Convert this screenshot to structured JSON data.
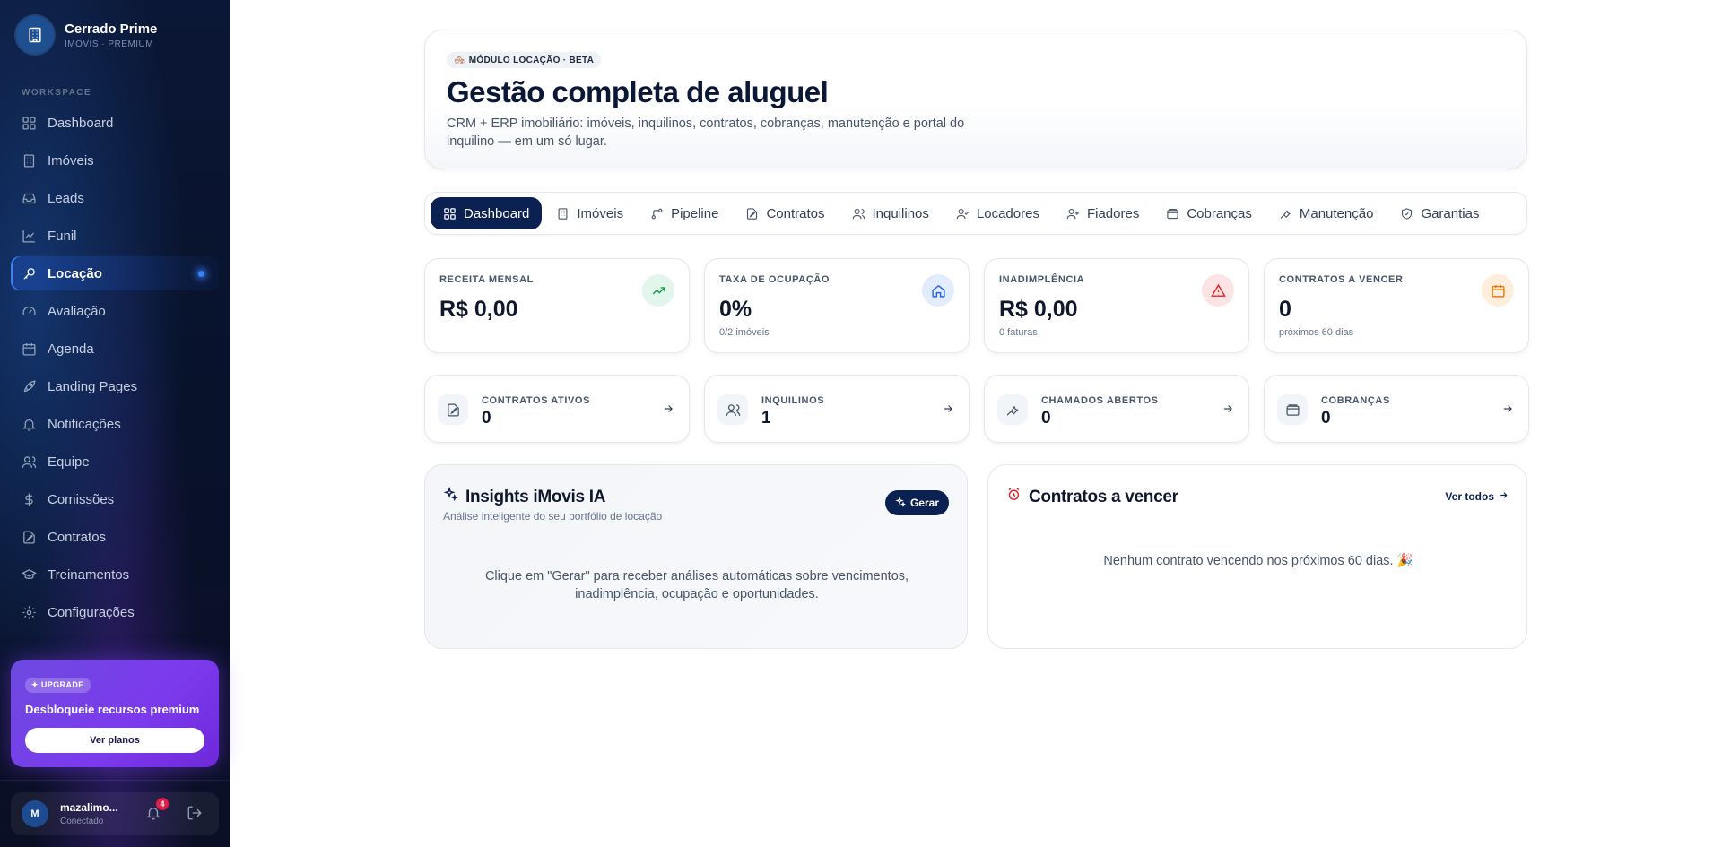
{
  "brand": {
    "name": "Cerrado Prime",
    "subtitle": "IMOVIS · PREMIUM"
  },
  "sidebar": {
    "section_label": "WORKSPACE",
    "items": [
      {
        "label": "Dashboard",
        "icon": "grid-icon"
      },
      {
        "label": "Imóveis",
        "icon": "building-icon"
      },
      {
        "label": "Leads",
        "icon": "inbox-icon"
      },
      {
        "label": "Funil",
        "icon": "chart-line-icon"
      },
      {
        "label": "Locação",
        "icon": "key-icon",
        "active": true
      },
      {
        "label": "Avaliação",
        "icon": "gauge-icon"
      },
      {
        "label": "Agenda",
        "icon": "calendar-icon"
      },
      {
        "label": "Landing Pages",
        "icon": "rocket-icon"
      },
      {
        "label": "Notificações",
        "icon": "bell-icon"
      },
      {
        "label": "Equipe",
        "icon": "users-icon"
      },
      {
        "label": "Comissões",
        "icon": "dollar-icon"
      },
      {
        "label": "Contratos",
        "icon": "file-signature-icon"
      },
      {
        "label": "Treinamentos",
        "icon": "graduation-cap-icon"
      },
      {
        "label": "Configurações",
        "icon": "gear-icon"
      }
    ],
    "upgrade": {
      "badge": "UPGRADE",
      "title": "Desbloqueie recursos premium",
      "button": "Ver planos"
    },
    "user": {
      "initial": "M",
      "name": "mazalimo...",
      "status": "Conectado",
      "notifications": "4"
    }
  },
  "hero": {
    "badge": "MÓDULO LOCAÇÃO · BETA",
    "title": "Gestão completa de aluguel",
    "description": "CRM + ERP imobiliário: imóveis, inquilinos, contratos, cobranças, manutenção e portal do inquilino — em um só lugar."
  },
  "tabs": [
    {
      "label": "Dashboard",
      "icon": "grid-icon",
      "active": true
    },
    {
      "label": "Imóveis",
      "icon": "building-icon"
    },
    {
      "label": "Pipeline",
      "icon": "git-branch-icon"
    },
    {
      "label": "Contratos",
      "icon": "file-signature-icon"
    },
    {
      "label": "Inquilinos",
      "icon": "users-icon"
    },
    {
      "label": "Locadores",
      "icon": "user-check-icon"
    },
    {
      "label": "Fiadores",
      "icon": "user-plus-icon"
    },
    {
      "label": "Cobranças",
      "icon": "wallet-icon"
    },
    {
      "label": "Manutenção",
      "icon": "wrench-icon"
    },
    {
      "label": "Garantias",
      "icon": "shield-icon"
    }
  ],
  "kpis": [
    {
      "label": "RECEITA MENSAL",
      "value": "R$ 0,00",
      "sub": "",
      "icon": "trending-up-icon",
      "color": "#16a34a",
      "bg": "#e3f6ec"
    },
    {
      "label": "TAXA DE OCUPAÇÃO",
      "value": "0%",
      "sub": "0/2 imóveis",
      "icon": "home-icon",
      "color": "#2563eb",
      "bg": "#e2ecfd"
    },
    {
      "label": "INADIMPLÊNCIA",
      "value": "R$ 0,00",
      "sub": "0 faturas",
      "icon": "alert-triangle-icon",
      "color": "#dc2626",
      "bg": "#fde4e4"
    },
    {
      "label": "CONTRATOS A VENCER",
      "value": "0",
      "sub": "próximos 60 dias",
      "icon": "calendar-icon",
      "color": "#ea7a0c",
      "bg": "#feeedb"
    }
  ],
  "summary": [
    {
      "label": "CONTRATOS ATIVOS",
      "value": "0",
      "icon": "file-signature-icon"
    },
    {
      "label": "INQUILINOS",
      "value": "1",
      "icon": "users-icon"
    },
    {
      "label": "CHAMADOS ABERTOS",
      "value": "0",
      "icon": "wrench-icon"
    },
    {
      "label": "COBRANÇAS",
      "value": "0",
      "icon": "wallet-icon"
    }
  ],
  "insights": {
    "title": "Insights iMovis IA",
    "subtitle": "Análise inteligente do seu portfólio de locação",
    "button": "Gerar",
    "message": "Clique em \"Gerar\" para receber análises automáticas sobre vencimentos, inadimplência, ocupação e oportunidades."
  },
  "expiring": {
    "title": "Contratos a vencer",
    "link": "Ver todos",
    "empty_message": "Nenhum contrato vencendo nos próximos 60 dias. 🎉"
  }
}
